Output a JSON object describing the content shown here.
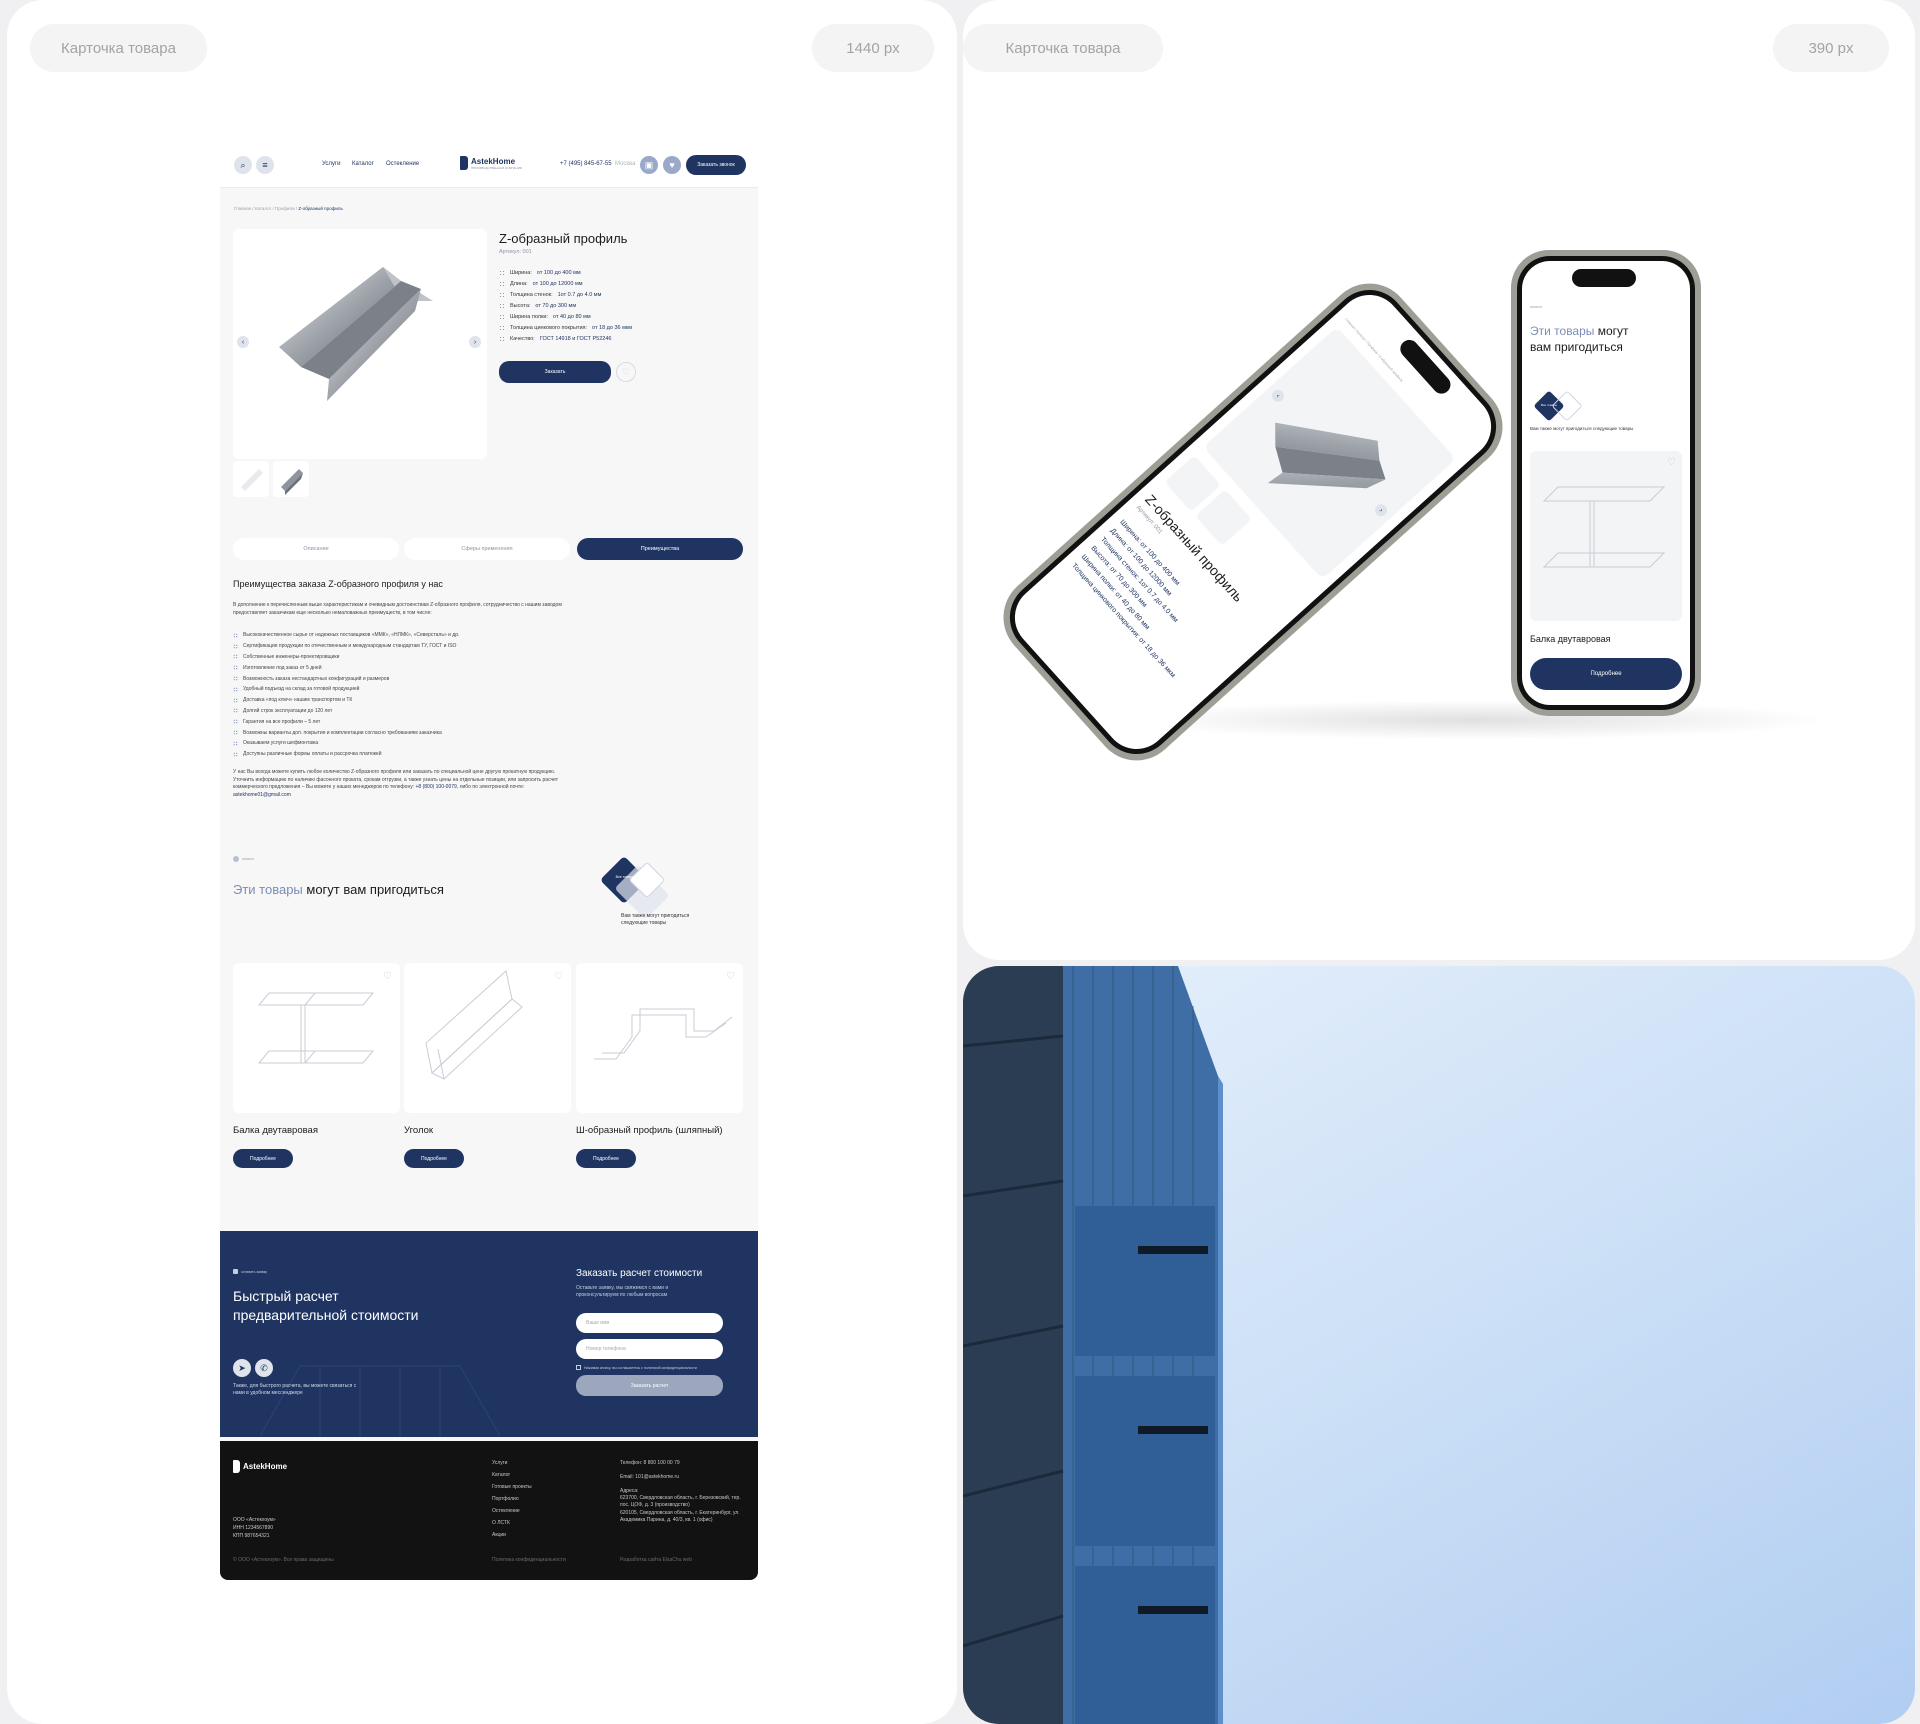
{
  "labels": {
    "left_title": "Карточка товара",
    "left_width": "1440 px",
    "right_title": "Карточка товара",
    "right_width": "390 px"
  },
  "site": {
    "header": {
      "nav": [
        "Услуги",
        "Каталог",
        "Остекление"
      ],
      "brand": "AstekHome",
      "brand_sub": "ПРОИЗВОДСТВЕННАЯ КОМПАНИЯ",
      "phone": "+7 (495) 845-67-55",
      "city": "Москва",
      "call_button": "Заказать звонок"
    },
    "breadcrumb": {
      "path": "Главная / Каталог / Профили / ",
      "current": "Z-образный профиль"
    },
    "product": {
      "title": "Z-образный профиль",
      "article": "Артикул: 001",
      "specs": [
        {
          "label": "Ширина:",
          "value": "от 100 до 400 мм"
        },
        {
          "label": "Длина:",
          "value": "от 100 до 12000 мм"
        },
        {
          "label": "Толщина стенок:",
          "value": "1от 0.7 до 4.0 мм"
        },
        {
          "label": "Высота:",
          "value": "от 70 до 300 мм"
        },
        {
          "label": "Ширина полки:",
          "value": "от 40 до 80 мм"
        },
        {
          "label": "Толщина цинкового покрытия:",
          "value": "от 18 до 36 мкм"
        },
        {
          "label": "Качество:",
          "value": "ГОСТ 14918 и ГОСТ Р52246"
        }
      ],
      "order_button": "Заказать"
    },
    "tabs": [
      "Описание",
      "Сферы применения",
      "Преимущества"
    ],
    "benefits_section": {
      "title": "Преимущества заказа Z-образного профиля у нас",
      "intro": "В дополнение к перечисленным выше характеристикам и очевидным достоинствам Z-образного профиля, сотрудничество с нашим заводом предоставляет заказчикам еще несколько немаловажных преимуществ, в том числе:",
      "items": [
        "Высококачественное сырье от надежных поставщиков «ММК», «НЛМК», «Северсталь» и др.",
        "Сертификация продукции по отечественным и международным стандартам ТУ, ГОСТ и ISO",
        "Собственные инженеры-проектировщики",
        "Изготовление под заказ от 5 дней",
        "Возможность заказа нестандартных конфигураций и размеров",
        "Удобный подъезд на склад за готовой продукцией",
        "Доставка «под ключ» нашим транспортом и ТК",
        "Долгий строк эксплуатации до 120 лет",
        "Гарантия на все профили – 5 лет",
        "Возможны варианты доп. покрытия и комплектации согласно требованиям заказчика",
        "Оказываем услуги шефмонтажа",
        "Доступны различные формы оплаты и рассрочка платежей"
      ],
      "outro": "У нас Вы всегда можете купить любое количество Z-образного профиля или заказать по специальной цене другую прокатную продукцию. Уточнить информацию по наличию фасонного проката, срокам отгрузки, а также узнать цены на отдельные позиции, или запросить расчет коммерческого предложения – Вы можете у наших менеджеров по телефону:",
      "phone": "+8 (800) 100-0079",
      "mid": ", либо по электронной почте: ",
      "email": "astekhome01@gmail.com"
    },
    "related": {
      "tag": "каталог",
      "title_light": "Эти товары",
      "title_dark": " могут вам пригодиться",
      "badge": "Все товары",
      "note": "Вам также могут пригодиться следующие товары",
      "items": [
        {
          "name": "Балка двутавровая",
          "button": "Подробнее"
        },
        {
          "name": "Уголок",
          "button": "Подробнее"
        },
        {
          "name": "Ш-образный профиль (шляпный)",
          "button": "Подробнее"
        }
      ]
    },
    "cta": {
      "tag": "оставить заявку",
      "title_line1": "Быстрый расчет",
      "title_line2": "предварительной стоимости",
      "messenger_note": "Также, для быстрого расчета, вы можете связаться с нами в удобном мессенджере",
      "form_title": "Заказать расчет стоимости",
      "form_sub": "Оставьте заявку, мы свяжемся с вами и проконсультируем по любым вопросам",
      "name_placeholder": "Ваше имя",
      "phone_placeholder": "Номер телефона",
      "consent": "Нажимая кнопку, вы соглашаетесь с политикой конфиденциальности",
      "submit": "Заказать расчет"
    },
    "footer": {
      "brand": "AstekHome",
      "company": "ООО «Астекхоум»",
      "inn": "ИНН 1234567890",
      "kpp": "КПП 987654321",
      "copyright": "© ООО «Астекхоум». Все права защищены",
      "links": [
        "Услуги",
        "Каталог",
        "Готовые проекты",
        "Портфолио",
        "Остекление",
        "О ЛСТК",
        "Акции"
      ],
      "policy": "Политика конфиденциальности",
      "phone": "Телефон: 8 800 100 00 79",
      "email": "Email: 101@astekhome.ru",
      "address_label": "Адреса:",
      "address1": "623700, Свердловская область, г. Березовский, тер. пос. ЦОФ, д. 3 (производство)",
      "address2": "620105, Свердловская область, г. Екатеринбург, ул. Академика Парина, д. 40/3, кв. 1 (офис)",
      "dev": "Разработка сайта ElsaChu web"
    }
  },
  "mobile": {
    "phone1": {
      "title": "Z-образный профиль",
      "article": "Артикул: 001",
      "specs": [
        "Ширина: от 100 до 400 мм",
        "Длина: от 100 до 12000 мм",
        "Толщина стенок: 1от 0.7 до 4.0 мм",
        "Высота: от 70 до 300 мм",
        "Ширина полки: от 40 до 80 мм",
        "Толщина цинкового покрытия: от 18 до 36 мкм"
      ],
      "crumb": "Главная / Каталог / Профили / Z-образный профиль"
    },
    "phone2": {
      "tag": "каталог",
      "title_light": "Эти товары",
      "title_dark": " могут вам пригодиться",
      "badge": "Все товары",
      "note": "Вам также могут пригодиться следующие товары",
      "card_name": "Балка двутавровая",
      "button": "Подробнее"
    }
  },
  "colors": {
    "brand_dark": "#1f3461",
    "accent_light": "#7a8db5",
    "footer": "#121212"
  }
}
